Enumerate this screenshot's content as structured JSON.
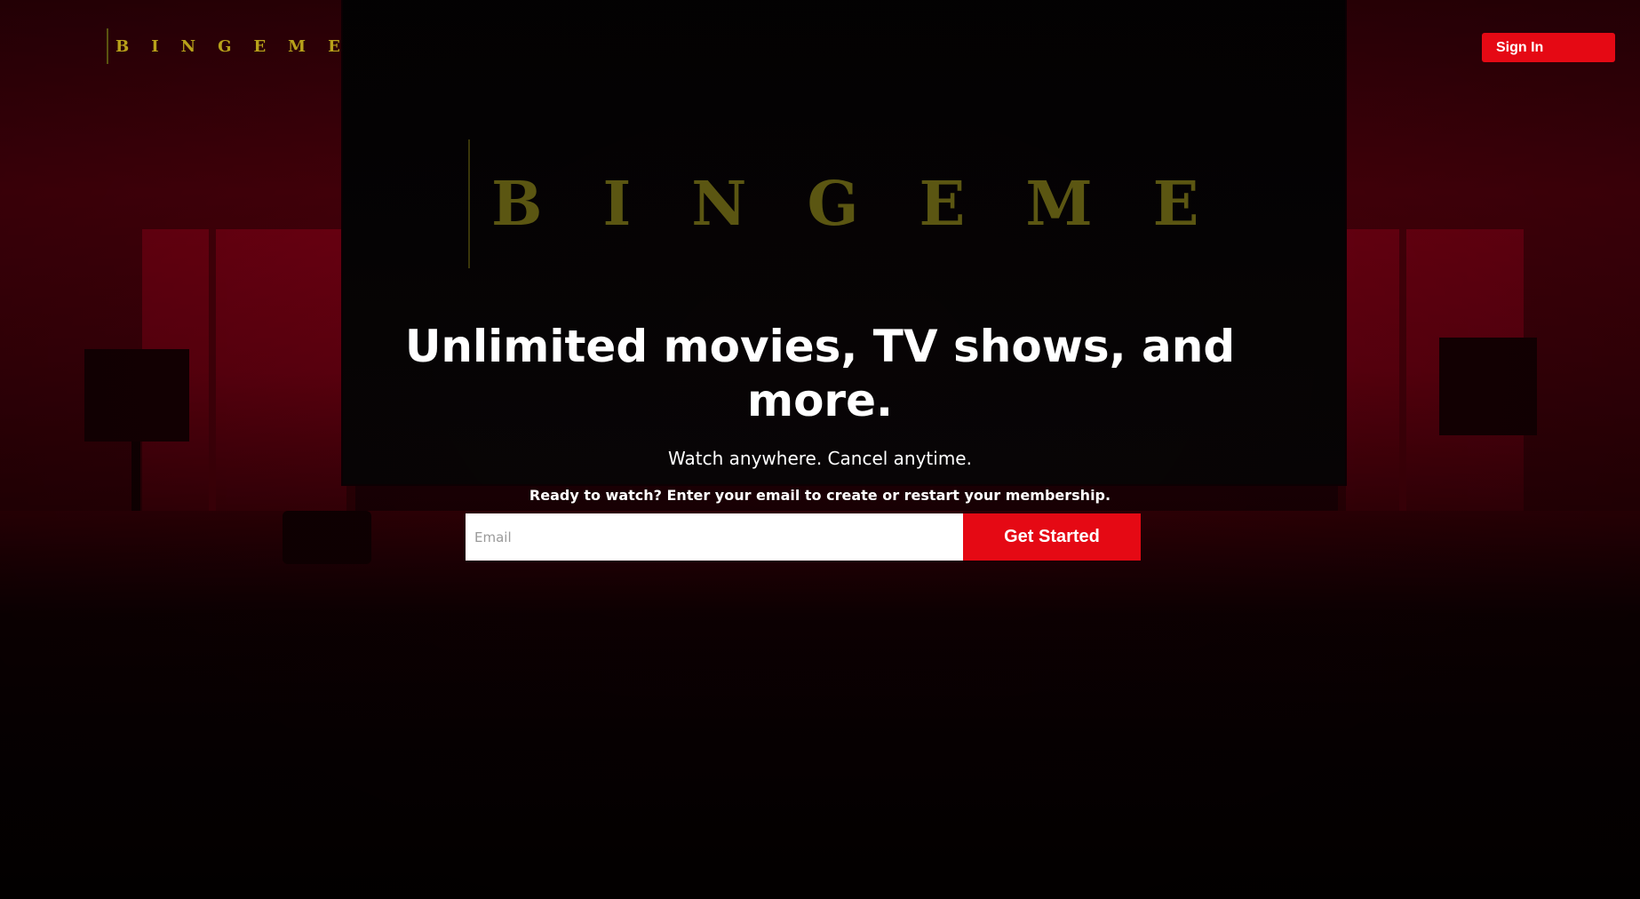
{
  "header": {
    "logo_text": "BINGEME",
    "sign_in_label": "Sign In"
  },
  "hero": {
    "logo_text": "BINGEME",
    "headline": "Unlimited movies, TV shows, and more.",
    "subhead": "Watch anywhere. Cancel anytime.",
    "prompt": "Ready to watch? Enter your email to create or restart your membership.",
    "email_placeholder": "Email",
    "cta_label": "Get Started"
  },
  "colors": {
    "accent": "#e50914",
    "logo_gold": "#b8a21a",
    "hero_logo_olive": "#5b5612",
    "background_red": "#5a000d"
  }
}
